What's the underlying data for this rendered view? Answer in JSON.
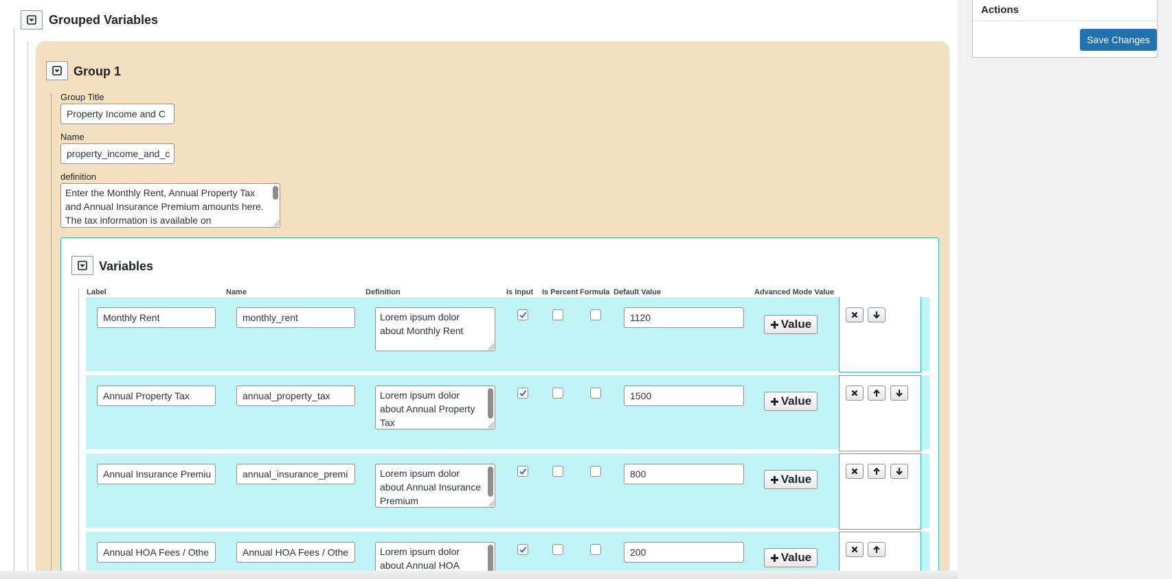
{
  "grouped_section": {
    "title": "Grouped Variables"
  },
  "group": {
    "title": "Group 1",
    "group_title_label": "Group Title",
    "group_title_value": "Property Income and C",
    "name_label": "Name",
    "name_value": "property_income_and_c",
    "definition_label": "definition",
    "definition_value": "Enter the Monthly Rent, Annual Property Tax and Annual Insurance Premium amounts here. The tax information is available on"
  },
  "variables_section": {
    "title": "Variables",
    "columns": {
      "label": "Label",
      "name": "Name",
      "definition": "Definition",
      "is_input": "Is Input",
      "is_percent": "Is Percent",
      "formula": "Formula",
      "default_value": "Default Value",
      "advanced_mode_value": "Advanced Mode Value"
    },
    "value_button_label": "Value",
    "rows": [
      {
        "label": "Monthly Rent",
        "name": "monthly_rent",
        "definition": "Lorem ipsum dolor about Monthly Rent",
        "is_input": true,
        "is_percent": false,
        "formula": false,
        "default_value": "1120"
      },
      {
        "label": "Annual Property Tax",
        "name": "annual_property_tax",
        "definition": "Lorem ipsum dolor about Annual Property Tax",
        "is_input": true,
        "is_percent": false,
        "formula": false,
        "default_value": "1500"
      },
      {
        "label": "Annual Insurance Premiu",
        "name": "annual_insurance_premi",
        "definition": "Lorem ipsum dolor about Annual Insurance Premium",
        "is_input": true,
        "is_percent": false,
        "formula": false,
        "default_value": "800"
      },
      {
        "label": "Annual HOA Fees / Othe",
        "name": "Annual HOA Fees / Othe",
        "definition": "Lorem ipsum dolor about Annual HOA Fees / Other",
        "is_input": true,
        "is_percent": false,
        "formula": false,
        "default_value": "200"
      }
    ]
  },
  "sidebar": {
    "actions_title": "Actions",
    "save_label": "Save Changes"
  },
  "colors": {
    "group_bg": "#f4dfc0",
    "row_bg": "#c0f4f4",
    "accent": "#2271b1",
    "panel_border": "#2fb7b7"
  },
  "icons": [
    "collapse-toggle-icon",
    "plus-icon",
    "delete-icon",
    "arrow-up-icon",
    "arrow-down-icon",
    "checkmark-icon"
  ]
}
